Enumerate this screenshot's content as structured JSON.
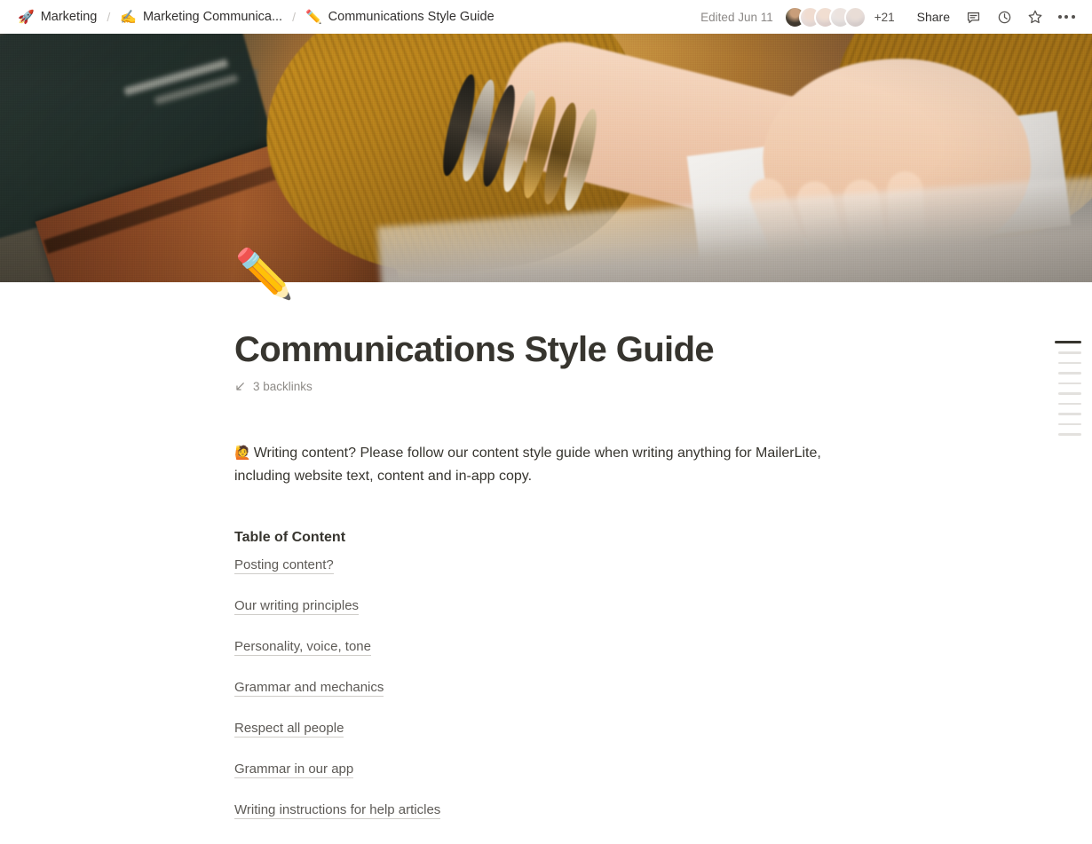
{
  "breadcrumb": {
    "items": [
      {
        "emoji": "🚀",
        "label": "Marketing",
        "icon_name": "rocket-icon"
      },
      {
        "emoji": "✍️",
        "label": "Marketing Communica...",
        "icon_name": "writing-hand-icon"
      },
      {
        "emoji": "✏️",
        "label": "Communications Style Guide",
        "icon_name": "pencil-icon"
      }
    ],
    "separator": "/"
  },
  "toolbar": {
    "edited_label": "Edited Jun 11",
    "collaborator_overflow": "+21",
    "share_label": "Share",
    "icons": [
      "comment-icon",
      "history-clock-icon",
      "star-icon",
      "more-options-icon"
    ]
  },
  "page": {
    "emoji": "✏️",
    "emoji_name": "pencil-icon",
    "title": "Communications Style Guide",
    "backlinks_label": "3 backlinks",
    "intro_emoji": "🙋",
    "intro_text": "Writing content? Please follow our content style guide when writing anything for MailerLite, including website text, content and in-app copy."
  },
  "toc": {
    "heading": "Table of Content",
    "links": [
      "Posting content?",
      "Our writing principles",
      "Personality, voice, tone",
      "Grammar and mechanics",
      "Respect all people",
      "Grammar in our app",
      "Writing instructions for help articles"
    ]
  },
  "outline": {
    "active_index": 0,
    "dash_widths": [
      30,
      26,
      26,
      26,
      26,
      26,
      26,
      26,
      26,
      26
    ]
  },
  "colors": {
    "text_primary": "#37352f",
    "text_muted": "#8e8b87",
    "link": "#5d5a56",
    "outline_active": "#37352f",
    "outline_inactive": "#e3e1de"
  }
}
